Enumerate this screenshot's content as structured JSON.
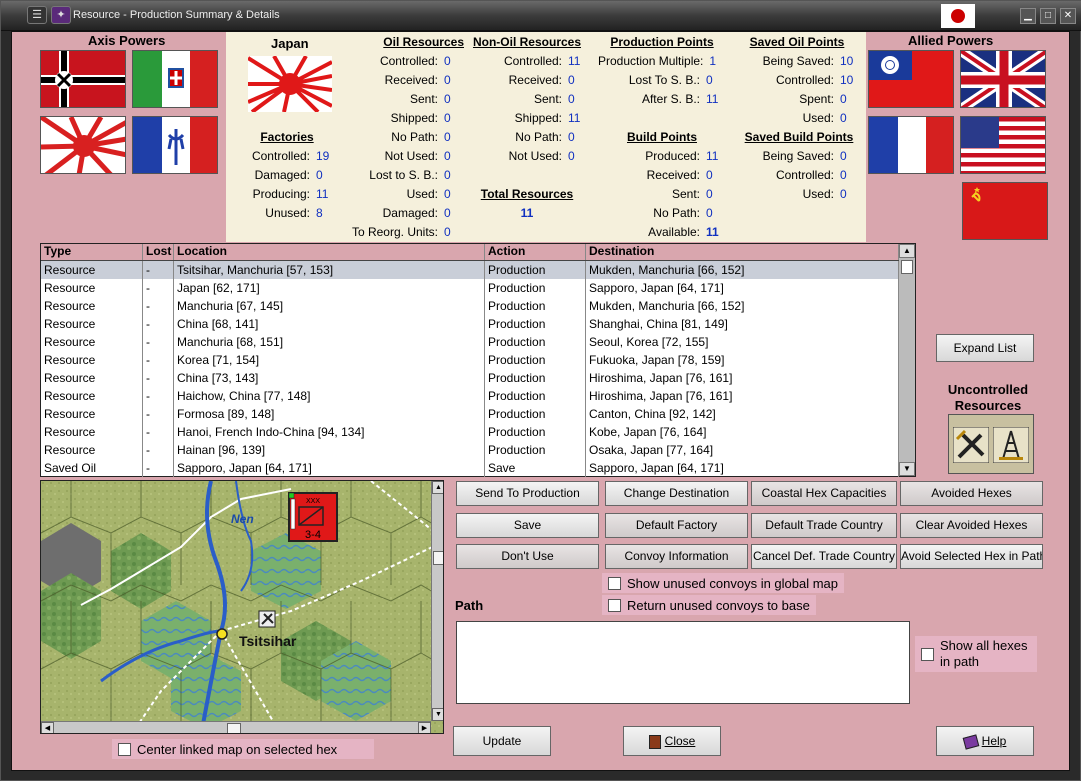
{
  "window": {
    "title": "Resource - Production Summary & Details"
  },
  "axis": {
    "label": "Axis Powers"
  },
  "allied": {
    "label": "Allied Powers"
  },
  "country": {
    "name": "Japan"
  },
  "factories": {
    "title": "Factories",
    "rows": [
      {
        "label": "Controlled:",
        "value": "19"
      },
      {
        "label": "Damaged:",
        "value": "0"
      },
      {
        "label": "Producing:",
        "value": "11"
      },
      {
        "label": "Unused:",
        "value": "8"
      }
    ]
  },
  "oil": {
    "title": "Oil Resources",
    "rows": [
      {
        "label": "Controlled:",
        "value": "0"
      },
      {
        "label": "Received:",
        "value": "0"
      },
      {
        "label": "Sent:",
        "value": "0"
      },
      {
        "label": "Shipped:",
        "value": "0"
      },
      {
        "label": "No Path:",
        "value": "0"
      },
      {
        "label": "Not Used:",
        "value": "0"
      },
      {
        "label": "Lost to S. B.:",
        "value": "0"
      },
      {
        "label": "Used:",
        "value": "0"
      },
      {
        "label": "Damaged:",
        "value": "0"
      },
      {
        "label": "To Reorg. Units:",
        "value": "0"
      }
    ]
  },
  "nonoil": {
    "title": "Non-Oil Resources",
    "rows": [
      {
        "label": "Controlled:",
        "value": "11"
      },
      {
        "label": "Received:",
        "value": "0"
      },
      {
        "label": "Sent:",
        "value": "0"
      },
      {
        "label": "Shipped:",
        "value": "11"
      },
      {
        "label": "No Path:",
        "value": "0"
      },
      {
        "label": "Not Used:",
        "value": "0"
      }
    ],
    "total_title": "Total Resources",
    "total_value": "11"
  },
  "pp": {
    "title": "Production Points",
    "rows": [
      {
        "label": "Production Multiple:",
        "value": "1"
      },
      {
        "label": "Lost To S. B.:",
        "value": "0"
      },
      {
        "label": "After S. B.:",
        "value": "11"
      }
    ]
  },
  "bp": {
    "title": "Build Points",
    "rows": [
      {
        "label": "Produced:",
        "value": "11"
      },
      {
        "label": "Received:",
        "value": "0"
      },
      {
        "label": "Sent:",
        "value": "0"
      },
      {
        "label": "No Path:",
        "value": "0"
      },
      {
        "label": "Available:",
        "value": "11"
      }
    ]
  },
  "soil": {
    "title": "Saved Oil Points",
    "rows": [
      {
        "label": "Being Saved:",
        "value": "10"
      },
      {
        "label": "Controlled:",
        "value": "10"
      },
      {
        "label": "Spent:",
        "value": "0"
      },
      {
        "label": "Used:",
        "value": "0"
      }
    ]
  },
  "sbp": {
    "title": "Saved Build Points",
    "rows": [
      {
        "label": "Being Saved:",
        "value": "0"
      },
      {
        "label": "Controlled:",
        "value": "0"
      },
      {
        "label": "Used:",
        "value": "0"
      }
    ]
  },
  "table": {
    "headers": [
      "Type",
      "Lost",
      "Location",
      "Action",
      "Destination"
    ],
    "rows": [
      [
        "Resource",
        "-",
        "Tsitsihar, Manchuria [57, 153]",
        "Production",
        "Mukden, Manchuria [66, 152]"
      ],
      [
        "Resource",
        "-",
        "Japan [62, 171]",
        "Production",
        "Sapporo, Japan [64, 171]"
      ],
      [
        "Resource",
        "-",
        "Manchuria [67, 145]",
        "Production",
        "Mukden, Manchuria [66, 152]"
      ],
      [
        "Resource",
        "-",
        "China [68, 141]",
        "Production",
        "Shanghai, China [81, 149]"
      ],
      [
        "Resource",
        "-",
        "Manchuria [68, 151]",
        "Production",
        "Seoul, Korea [72, 155]"
      ],
      [
        "Resource",
        "-",
        "Korea [71, 154]",
        "Production",
        "Fukuoka, Japan [78, 159]"
      ],
      [
        "Resource",
        "-",
        "China [73, 143]",
        "Production",
        "Hiroshima, Japan [76, 161]"
      ],
      [
        "Resource",
        "-",
        "Haichow, China [77, 148]",
        "Production",
        "Hiroshima, Japan [76, 161]"
      ],
      [
        "Resource",
        "-",
        "Formosa [89, 148]",
        "Production",
        "Canton, China [92, 142]"
      ],
      [
        "Resource",
        "-",
        "Hanoi, French Indo-China [94, 134]",
        "Production",
        "Kobe, Japan [76, 164]"
      ],
      [
        "Resource",
        "-",
        "Hainan [96, 139]",
        "Production",
        "Osaka, Japan [77, 164]"
      ],
      [
        "Saved Oil",
        "-",
        "Sapporo, Japan [64, 171]",
        "Save",
        "Sapporo, Japan [64, 171]"
      ]
    ]
  },
  "expand_list": "Expand List",
  "uncontrolled": "Uncontrolled Resources",
  "map": {
    "river": "Nen",
    "city": "Tsitsihar",
    "unit_top": "XXX",
    "unit_strength": "3-4"
  },
  "buttons": {
    "send_to_production": "Send To Production",
    "change_destination": "Change Destination",
    "coastal_hex": "Coastal Hex Capacities",
    "avoided_hexes": "Avoided Hexes",
    "save": "Save",
    "default_factory": "Default Factory",
    "default_trade": "Default Trade Country",
    "clear_avoided": "Clear Avoided Hexes",
    "dont_use": "Don't Use",
    "convoy_info": "Convoy Information",
    "cancel_def_trade": "Cancel Def. Trade Country",
    "avoid_selected": "Avoid Selected Hex in Path",
    "update": "Update",
    "close": "Close",
    "help": "Help"
  },
  "checks": {
    "show_unused": "Show unused convoys in global map",
    "return_unused": "Return unused convoys to base",
    "show_all_hexes": "Show all hexes in path",
    "center_map": "Center linked map on selected hex"
  },
  "path_label": "Path"
}
